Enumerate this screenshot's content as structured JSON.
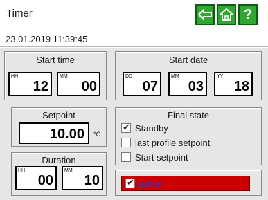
{
  "header": {
    "title": "Timer",
    "nav": {
      "back_icon": "back-arrow-icon",
      "home_icon": "home-icon",
      "help_label": "?"
    }
  },
  "datetime": "23.01.2019 11:39:45",
  "start_time": {
    "title": "Start time",
    "hour": {
      "caption": "HH",
      "value": "12"
    },
    "minute": {
      "caption": "MM",
      "value": "00"
    }
  },
  "start_date": {
    "title": "Start date",
    "day": {
      "caption": "DD",
      "value": "07"
    },
    "month": {
      "caption": "MM",
      "value": "03"
    },
    "year": {
      "caption": "YY",
      "value": "18"
    }
  },
  "setpoint": {
    "title": "Setpoint",
    "value": "10.00",
    "unit": "°C"
  },
  "duration": {
    "title": "Duration",
    "hour": {
      "caption": "HH",
      "value": "00"
    },
    "minute": {
      "caption": "MM",
      "value": "10"
    }
  },
  "final_state": {
    "title": "Final state",
    "options": [
      {
        "label": "Standby",
        "checked": true
      },
      {
        "label": "last profile setpoint",
        "checked": false
      },
      {
        "label": "Start setpoint",
        "checked": false
      }
    ]
  },
  "active": {
    "label": "active",
    "checked": true
  },
  "colors": {
    "nav_green": "#2fa82f",
    "active_red": "#cc0000",
    "active_text": "#2a3bd8",
    "panel_bg": "#e6e6e6"
  }
}
